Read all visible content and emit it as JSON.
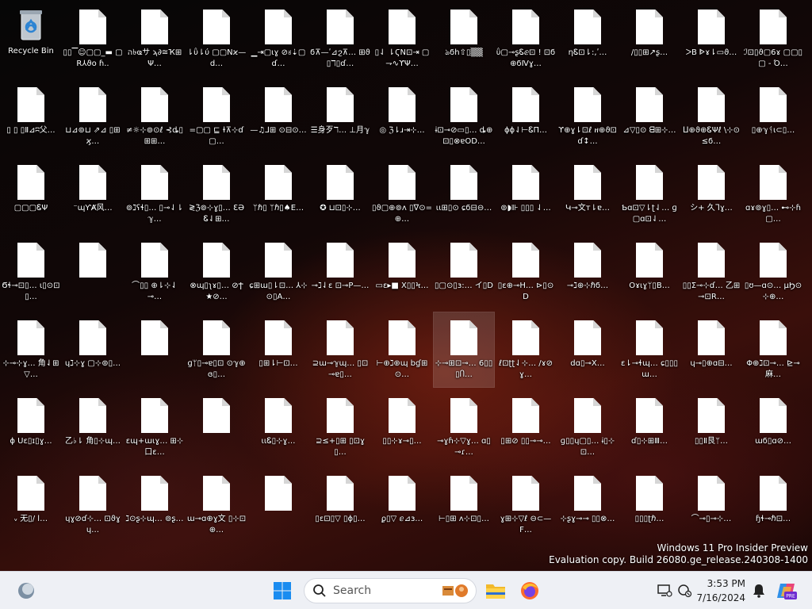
{
  "recycle_bin": {
    "label": "Recycle Bin"
  },
  "desktop_files": [
    "▯▯▔☺▢▢_▬\n▢R⅄ϑo ɦ..",
    "ה৳ҩサ\nϡ∂≅Ҡ⊞Ψ…",
    "⇂ΰ⇂ύ\n▢▢Nϰ—d…",
    "▁⇥▢ɩɣ\n⊘ಕ⇣▢ɗ…",
    "ϭ⊼—ʹ⊿ϩ⊼…\n⊞ϑ▯ℸ▯ɗ…",
    "▯⇃ ⇂ϚN⊡⇥\n▢⇁∿ϒΨ…",
    "ঌϭh⇧▯▒▒",
    "ΰ▢⊸ʂᏋⅇ⊡ !\n⊡ϭ⊕ϭⅣɣ…",
    "ηᏋ⊡⇂:,ʹ…",
    "/▯▯⊞↗ʂ…",
    "ᐳB\nᐈɤ⇂▭ϑ…",
    "ℐ⊡▯ϑ▢6ɤ\n▢▢▯▢ - Ό…",
    "▯ ▯\n▯Ⅱ⊿ʭ父…",
    "⊔⊿⊚⊔\n⇗⊿ ▯⊞ϗ…",
    "≠☼⊹⊚⊙ℓ\n⊰ȡ▯⊞⊞…",
    "=▢▢ ⊑\nɫ⊼⊹ɗ▢…",
    "—♫⅃⊞\n⊙⊟⊙…",
    "☰身歹ℸ…\n⊥月ℽ",
    "◎\nℨ⇂ɹ⇥⊹…",
    "ɨ⊡⊸⊘▭▯…\nȡ⊕⊡▯⊗ɐOD…",
    "ɸɸ⇃⊢ᏋΠ…",
    "ϒ⊕ɣ⇂⊡ℓ\nዘ⊕ϑ⊡ɗ↕…",
    "⊿▽▯⊙\nᗺ⊞⊹…",
    "ⵡ⊕ϑ⊕ᏋΨℓ\n\\⊹⊙≤ϭ…",
    "▯⊕ℽᛩɩ⊂▯…",
    "▢▢▢ᏋΨ",
    "⁻ɰƳȺ风…",
    "⊚ℷʕɬ▯…\n▯⊸⇃⇂ℽ…",
    "≷ℨ⊚⊹ɣ▯…\nƐƏᏋ⇃⊞…",
    "ᛘℏ▯\nᛘℏ▯♠E…",
    "✪\n⊔⊡▯⊹…",
    "▯ϑ▢⊕⊚ʌ\n▯∇⊙=⊕…",
    "ɩɩ⊞▯⊙\nɕϭ⊟⊖…",
    "⊚◗⊪\n▯▯▯ ⇃…",
    "Կ⊸文ᴛ⇂ɐ…",
    "Ƅɑ⊡▽⇂ʈ⇃…\nɡ▢ɑ⊡⇃…",
    "シ+\n久ᒣɣ…",
    "ɑɤ⊚ɣ▯…\n⊷⊹ɦ▢…",
    "Ϭɬ⊸⊡▯…\nɩ▯⊙⊡▯…",
    "",
    "⌒▯▯\n⊕⇂⊹⇃⊸…",
    "⊗ɰ▯ʅɤ▯…\n⊘Ϯ★⊘…",
    "ɕ⊞ɯ▯⇂⊡…\n⅄⊹⊙▯A…",
    "⊸ℷ⇃ɛ\n⊡⊸Ρ—…",
    "▭ɛ▸■\nX▯▯Ϟ…",
    "▯▢⊙▯ɜ:…\nイ▯Ⅾ",
    "▯ɛ⊕⊸H…\n⊳▯⊙D",
    "⊸ℷ⊕⊹ℏϭ…",
    "Oɤɩɣᛘ▯B…",
    "▯▯Σ⊸⊹ɗ…\n乙⊞⊸⊡R…",
    "▯ʊ—ɑ⊙…\nμϦ⊙⊹⊕…",
    "⊹⊸⊹ɣ…\n角⇃⊞▽…",
    "ɥℷ⊹ɣ\n▢⊹⊚▯…",
    "",
    "ɡᛘ▯⊸ɐ▯⊡\n⊙ℽ⊕ɞ▯…",
    "▯⊞⇂⊢⊡…",
    "⊇ɯ⊸ℽɰ…\n▯⊡⊸ɐ▯…",
    "⊢⊕ℷ⊕ɰ\nbɠ⊞⊙…",
    "⊹⊸⊞⊡⊸…\n6▯▯▯Ⴖ…",
    "ℓ⊡ʈʈ⇃⊹…\n/ɤ⊘ɣ…",
    "dɑ▯⊸X…",
    "ɛ⇂⊸ɬɰ…\nɕ▯▯▯ɯ…",
    "ɥ⊸▯⊕ɑ⊟…",
    "Φ⊕ℷ⊡⊸…\n⊵⊸麻…",
    "ɸ\nUɛ▯ɪ▯ɣ…",
    "乙♭⇂\n角▯⊹ɰ…",
    "ɛɰ+ɯɩɣ…\n⊞⊹口ɛ…",
    "",
    "ɩɩᏋ▯⊹ɣ…",
    "⊇≤+▯⊞\n▯⊡ɣ▯…",
    "▯▯⊹ɤ⊸▯…",
    "⊸ɣɦ⊹▽ɣ…\nɑ▯⊸ɾ…",
    "▯⊞⊘\n▯▯⊸⊸…",
    "ɡ▯▯ɥ▢▯…\nɨ▯⊹⊡…",
    "ɗ▯⊹⊞Ⅲ…",
    "▯▯Ⅱ艮ᛘ…",
    "ɯϭ▯ɑ⊘…",
    "ᵥ\n无▯/ ⅼ…",
    "ɥɣ⊘ɗ⊹…\n⊡ϑɣɥ…",
    "ℷ⊙ʂ⊹ɰ…\n⊚ʂ…",
    "ɯ⊸ɑ⊕ɣ文\n▯⊹⊡⊕…",
    "",
    "▯ɛ⊡▯▽\n▯ɸ▯…",
    "ϼ▯▽\nⅇ⊿ɜ…",
    "⊢▯⊞\nʌ⊹⊡▯…",
    "ɣ⊞⊹▽ℓ\n⊖⊂—F…",
    "⊹ʂɣ⊸⊸\n▯▯⊗…",
    "▯▯▯ʈℏ…",
    "⌒⊸▯⊸⊹…",
    "ɧɬ⊸ℏ⊡…",
    "ɥɛɤ⇂▯…\n⊥ɛ",
    "ɛⅇɜ\n羊ℽɛ…",
    "▯ɳ⊕ɦ⊸…\n⊡⊙⊹…",
    "ɛʃɩ⊹⊹ɯ…\nɛ⊹▯…",
    "ɭ⊡ɜ⊹ℷ⊡\n⊘ɣɦ⊹▯…",
    ""
  ],
  "selected_file_index": 58,
  "watermark": {
    "line1": "Windows 11 Pro Insider Preview",
    "line2": "Evaluation copy. Build 26080.ge_release.240308-1400"
  },
  "taskbar": {
    "search_placeholder": "Search",
    "clock_time": "3:53 PM",
    "clock_date": "7/16/2024",
    "copilot_badge": "PRE"
  }
}
